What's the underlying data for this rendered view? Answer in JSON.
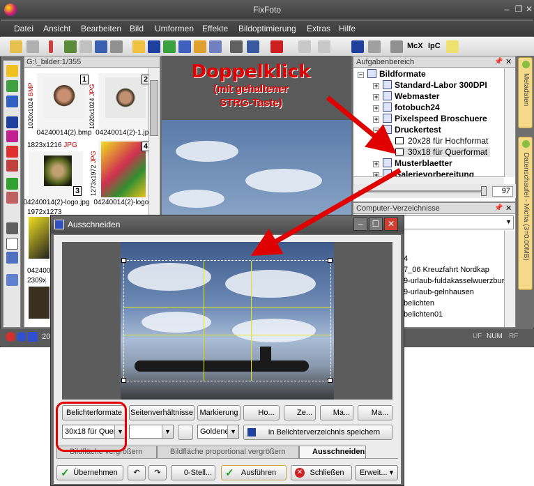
{
  "app": {
    "title": "FixFoto",
    "logo_text": "FF"
  },
  "menu": [
    "Datei",
    "Ansicht",
    "Bearbeiten",
    "Bild",
    "Umformen",
    "Effekte",
    "Bildoptimierung",
    "Extras",
    "Hilfe"
  ],
  "toolbar": {
    "mcx_label": "McX",
    "ipc_label": "IpC"
  },
  "thumbs": {
    "path": "G:\\_bilder:1/355",
    "items": [
      {
        "num": "1",
        "dims": "1020x1024",
        "fmt": "BMP",
        "caption": "04240014(2).bmp"
      },
      {
        "num": "2",
        "dims": "1020x1024",
        "fmt": "JPG",
        "caption": "04240014(2)-1.jpg"
      },
      {
        "num": "3",
        "dims": "1823x1216",
        "fmt": "JPG",
        "caption": "04240014(2)-logo.jpg"
      },
      {
        "num": "4",
        "dims": "1273x1972",
        "fmt": "JPG",
        "caption": "04240014(2)-logo..."
      }
    ],
    "extra_dims": "1972x1273",
    "extra_caption": "042400",
    "extra_dims2": "2309x"
  },
  "tasks": {
    "title": "Aufgabenbereich",
    "root": "Bildformate",
    "items": [
      "Standard-Labor 300DPI",
      "Webmaster",
      "fotobuch24",
      "Pixelspeed Broschuere",
      "Druckertest"
    ],
    "sub": [
      "20x28 für Hochformat",
      "30x18 für Querformat"
    ],
    "after": [
      "Musterblaetter",
      "Galerievorbereitung"
    ],
    "slider_value": "97"
  },
  "directories": {
    "title": "Computer-Verzeichnisse",
    "items": [
      "4",
      "7_06 Kreuzfahrt Nordkap",
      "9-urlaub-fuldakasselwuerzburg",
      "9-urlaub-gelnhausen",
      "belichten",
      "belichten01"
    ]
  },
  "sidetabs": {
    "meta": "Metadaten",
    "clipboard": "Datenschaufel - Micha (3=0.00MB)"
  },
  "status": {
    "left": "20",
    "uf": "UF",
    "num": "NUM",
    "rf": "RF"
  },
  "annotation": {
    "title": "Doppelklick",
    "line1": "(mit gehaltener",
    "line2": "STRG-Taste)"
  },
  "dialog": {
    "title": "Ausschneiden",
    "tabs_top": [
      "Belichterformate",
      "Seitenverhältnisse",
      "Markierung"
    ],
    "buttons_top": [
      "Ho...",
      "Ze...",
      "Ma...",
      "Ma..."
    ],
    "format_select": "30x18 für Quer",
    "golden_select": "Goldene",
    "save_button": "in Belichterverzeichnis speichern",
    "tabs_bottom": [
      "Bildfläche vergrößern",
      "Bildfläche proportional vergrößern",
      "Ausschneiden"
    ],
    "actions": {
      "apply": "Übernehmen",
      "zero": "0-Stell...",
      "run": "Ausführen",
      "close": "Schließen",
      "extend": "Erweit..."
    }
  }
}
